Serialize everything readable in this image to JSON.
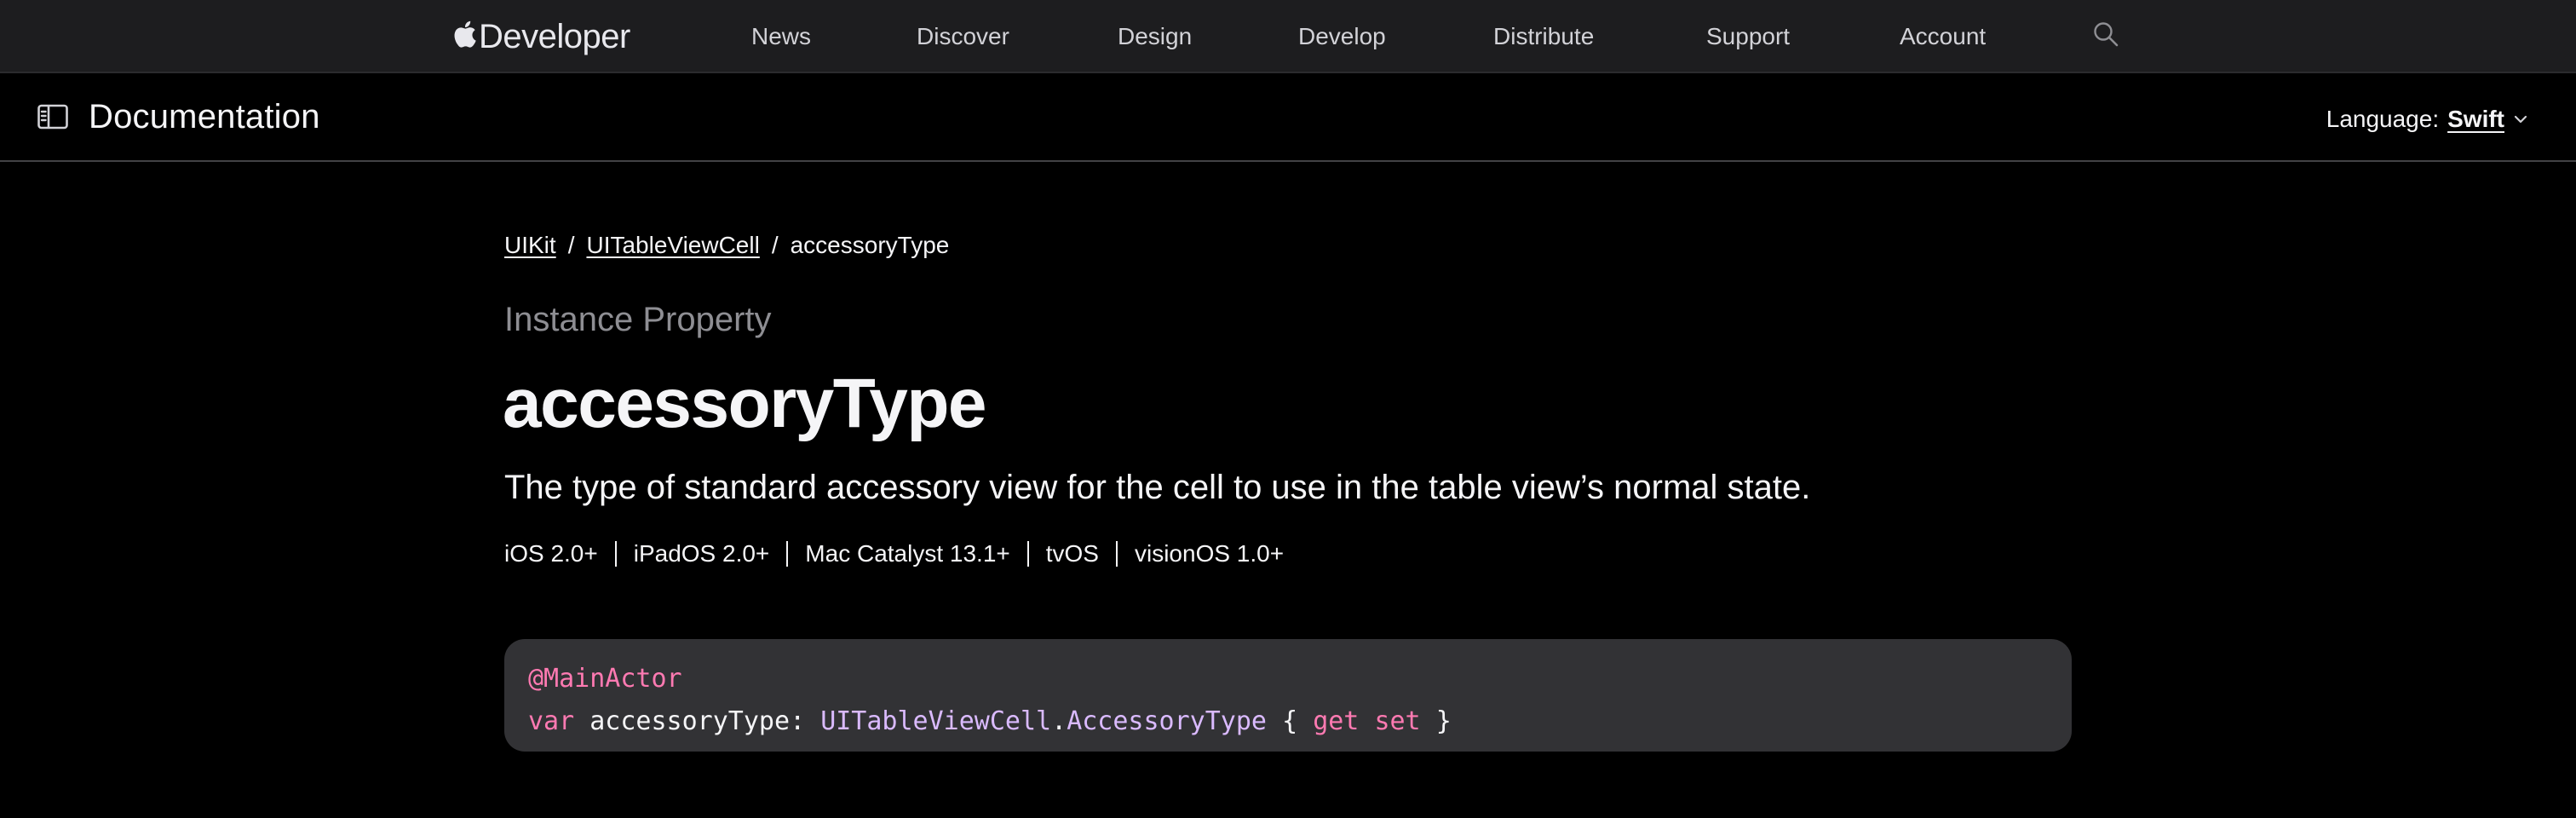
{
  "global_nav": {
    "logo_text": "Developer",
    "links": [
      "News",
      "Discover",
      "Design",
      "Develop",
      "Distribute",
      "Support",
      "Account"
    ]
  },
  "doc_header": {
    "title": "Documentation",
    "language_label": "Language:",
    "language_value": "Swift"
  },
  "breadcrumb": {
    "items": [
      "UIKit",
      "UITableViewCell",
      "accessoryType"
    ],
    "separator": "/"
  },
  "content": {
    "eyebrow": "Instance Property",
    "title": "accessoryType",
    "abstract": "The type of standard accessory view for the cell to use in the table view’s normal state.",
    "platforms": [
      "iOS 2.0+",
      "iPadOS 2.0+",
      "Mac Catalyst 13.1+",
      "tvOS",
      "visionOS 1.0+"
    ]
  },
  "declaration": {
    "attribute": "@MainActor",
    "keyword_var": "var",
    "name": "accessoryType",
    "colon": ":",
    "type_owner": "UITableViewCell",
    "dot": ".",
    "type_name": "AccessoryType",
    "open_brace": "{",
    "keyword_get": "get",
    "keyword_set": "set",
    "close_brace": "}"
  },
  "colors": {
    "nav_bg": "#1d1d1f",
    "page_bg": "#000000",
    "code_bg": "#323235",
    "keyword": "#ff7ab2",
    "type": "#dabaff",
    "muted_text": "#8e8e93"
  }
}
